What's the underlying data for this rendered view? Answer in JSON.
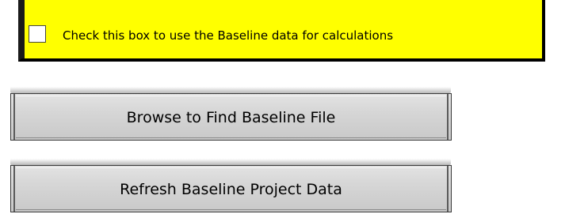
{
  "baseline_option": {
    "checkbox_label": "Check this box to use the Baseline data for calculations",
    "checked": false,
    "panel_color": "#ffff00"
  },
  "buttons": {
    "browse_label": "Browse to Find Baseline File",
    "refresh_label": "Refresh Baseline Project Data"
  }
}
